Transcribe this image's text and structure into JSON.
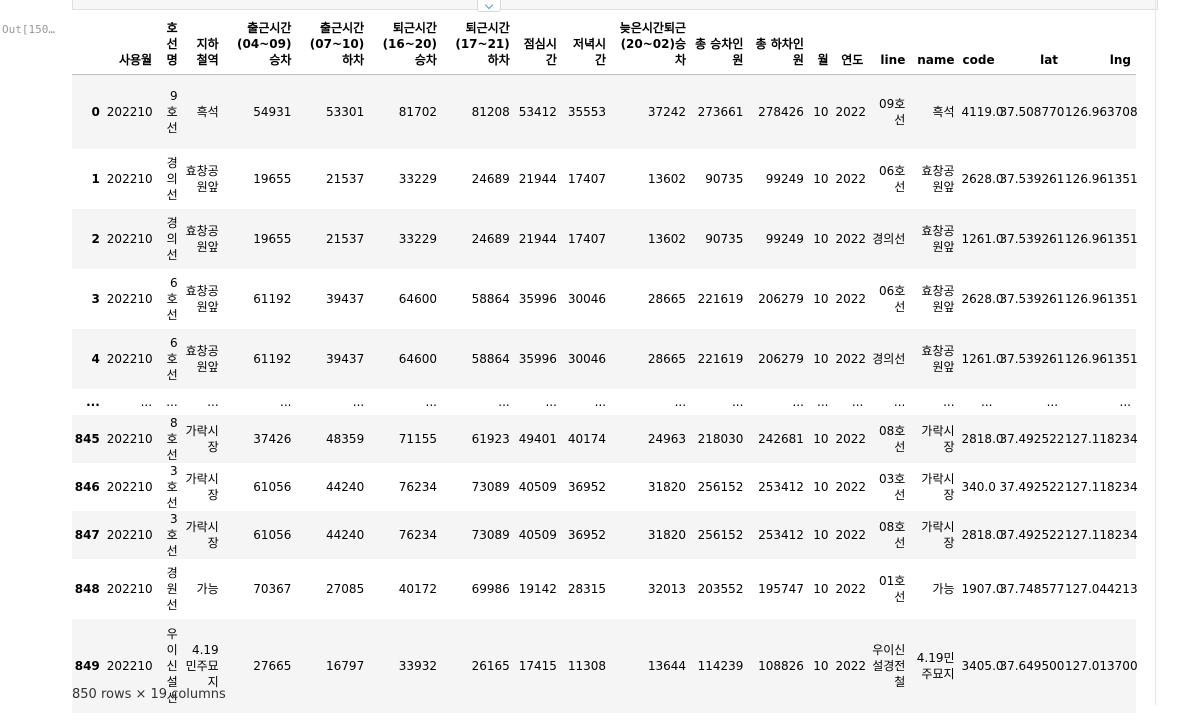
{
  "prompt": {
    "label": "Out[150…"
  },
  "table": {
    "columns": [
      "",
      "사용월",
      "호선명",
      "지하철역",
      "출근시간(04~09)승차",
      "출근시간(07~10)하차",
      "퇴근시간(16~20)승차",
      "퇴근시간(17~21)하차",
      "점심시간",
      "저녁시간",
      "늦은시간퇴근(20~02)승차",
      "총 승차인원",
      "총 하차인원",
      "월",
      "연도",
      "line",
      "name",
      "code",
      "lat",
      "lng"
    ],
    "rows": [
      {
        "h": 74,
        "cells": [
          "0",
          "202210",
          "9호선",
          "흑석",
          "54931",
          "53301",
          "81702",
          "81208",
          "53412",
          "35553",
          "37242",
          "273661",
          "278426",
          "10",
          "2022",
          "09호선",
          "흑석",
          "4119.0",
          "37.508770",
          "126.963708"
        ]
      },
      {
        "h": 60,
        "cells": [
          "1",
          "202210",
          "경의선",
          "효창공원앞",
          "19655",
          "21537",
          "33229",
          "24689",
          "21944",
          "17407",
          "13602",
          "90735",
          "99249",
          "10",
          "2022",
          "06호선",
          "효창공원앞",
          "2628.0",
          "37.539261",
          "126.961351"
        ]
      },
      {
        "h": 60,
        "cells": [
          "2",
          "202210",
          "경의선",
          "효창공원앞",
          "19655",
          "21537",
          "33229",
          "24689",
          "21944",
          "17407",
          "13602",
          "90735",
          "99249",
          "10",
          "2022",
          "경의선",
          "효창공원앞",
          "1261.0",
          "37.539261",
          "126.961351"
        ]
      },
      {
        "h": 60,
        "cells": [
          "3",
          "202210",
          "6호선",
          "효창공원앞",
          "61192",
          "39437",
          "64600",
          "58864",
          "35996",
          "30046",
          "28665",
          "221619",
          "206279",
          "10",
          "2022",
          "06호선",
          "효창공원앞",
          "2628.0",
          "37.539261",
          "126.961351"
        ]
      },
      {
        "h": 60,
        "cells": [
          "4",
          "202210",
          "6호선",
          "효창공원앞",
          "61192",
          "39437",
          "64600",
          "58864",
          "35996",
          "30046",
          "28665",
          "221619",
          "206279",
          "10",
          "2022",
          "경의선",
          "효창공원앞",
          "1261.0",
          "37.539261",
          "126.961351"
        ]
      },
      {
        "h": 26,
        "cells": [
          "...",
          "...",
          "...",
          "...",
          "...",
          "...",
          "...",
          "...",
          "...",
          "...",
          "...",
          "...",
          "...",
          "...",
          "...",
          "...",
          "...",
          "...",
          "...",
          "..."
        ]
      },
      {
        "h": 44,
        "cells": [
          "845",
          "202210",
          "8호선",
          "가락시장",
          "37426",
          "48359",
          "71155",
          "61923",
          "49401",
          "40174",
          "24963",
          "218030",
          "242681",
          "10",
          "2022",
          "08호선",
          "가락시장",
          "2818.0",
          "37.492522",
          "127.118234"
        ]
      },
      {
        "h": 44,
        "cells": [
          "846",
          "202210",
          "3호선",
          "가락시장",
          "61056",
          "44240",
          "76234",
          "73089",
          "40509",
          "36952",
          "31820",
          "256152",
          "253412",
          "10",
          "2022",
          "03호선",
          "가락시장",
          "340.0",
          "37.492522",
          "127.118234"
        ]
      },
      {
        "h": 44,
        "cells": [
          "847",
          "202210",
          "3호선",
          "가락시장",
          "61056",
          "44240",
          "76234",
          "73089",
          "40509",
          "36952",
          "31820",
          "256152",
          "253412",
          "10",
          "2022",
          "08호선",
          "가락시장",
          "2818.0",
          "37.492522",
          "127.118234"
        ]
      },
      {
        "h": 60,
        "cells": [
          "848",
          "202210",
          "경원선",
          "가능",
          "70367",
          "27085",
          "40172",
          "69986",
          "19142",
          "28315",
          "32013",
          "203552",
          "195747",
          "10",
          "2022",
          "01호선",
          "가능",
          "1907.0",
          "37.748577",
          "127.044213"
        ]
      },
      {
        "h": 94,
        "cells": [
          "849",
          "202210",
          "우이신설선",
          "4.19민주묘지",
          "27665",
          "16797",
          "33932",
          "26165",
          "17415",
          "11308",
          "13644",
          "114239",
          "108826",
          "10",
          "2022",
          "우이신설경전철",
          "4.19민주묘지",
          "3405.0",
          "37.649500",
          "127.013700"
        ]
      }
    ]
  },
  "footer": {
    "summary": "850 rows × 19 columns"
  }
}
